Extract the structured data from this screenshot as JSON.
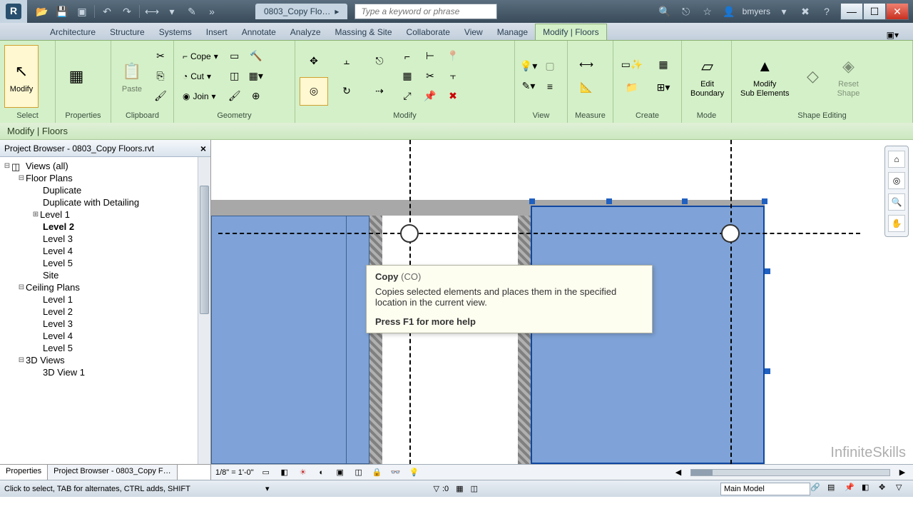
{
  "title": {
    "document_short": "0803_Copy Flo…",
    "search_placeholder": "Type a keyword or phrase",
    "user": "bmyers"
  },
  "ribbon": {
    "tabs": [
      "Architecture",
      "Structure",
      "Systems",
      "Insert",
      "Annotate",
      "Analyze",
      "Massing & Site",
      "Collaborate",
      "View",
      "Manage",
      "Modify | Floors"
    ],
    "panels": {
      "select": "Select",
      "properties": "Properties",
      "clipboard": "Clipboard",
      "geometry": "Geometry",
      "modify": "Modify",
      "view": "View",
      "measure": "Measure",
      "create": "Create",
      "mode": "Mode",
      "shape": "Shape Editing"
    },
    "buttons": {
      "modify": "Modify",
      "paste": "Paste",
      "cope": "Cope",
      "cut": "Cut",
      "join": "Join",
      "edit_boundary": "Edit\nBoundary",
      "modify_sub": "Modify\nSub Elements",
      "reset_shape": "Reset\nShape"
    }
  },
  "context_bar": "Modify | Floors",
  "project_browser": {
    "title": "Project Browser - 0803_Copy Floors.rvt",
    "root": "Views (all)",
    "floor_plans": {
      "label": "Floor Plans",
      "items": [
        "Duplicate",
        "Duplicate with Detailing",
        "Level 1",
        "Level 2",
        "Level 3",
        "Level 4",
        "Level 5",
        "Site"
      ]
    },
    "ceiling_plans": {
      "label": "Ceiling Plans",
      "items": [
        "Level 1",
        "Level 2",
        "Level 3",
        "Level 4",
        "Level 5"
      ]
    },
    "threed": {
      "label": "3D Views",
      "items": [
        "3D View 1"
      ]
    },
    "bottom_tabs": {
      "properties": "Properties",
      "pb": "Project Browser - 0803_Copy F…"
    }
  },
  "tooltip": {
    "title": "Copy",
    "shortcut": "(CO)",
    "body": "Copies selected elements and places them in the specified location in the current view.",
    "help": "Press F1 for more help"
  },
  "view_controls": {
    "scale": "1/8\" = 1'-0\""
  },
  "status": {
    "msg": "Click to select, TAB for alternates, CTRL adds, SHIFT",
    "filter_count": ":0",
    "workset": "Main Model"
  },
  "watermark": "InfiniteSkills"
}
